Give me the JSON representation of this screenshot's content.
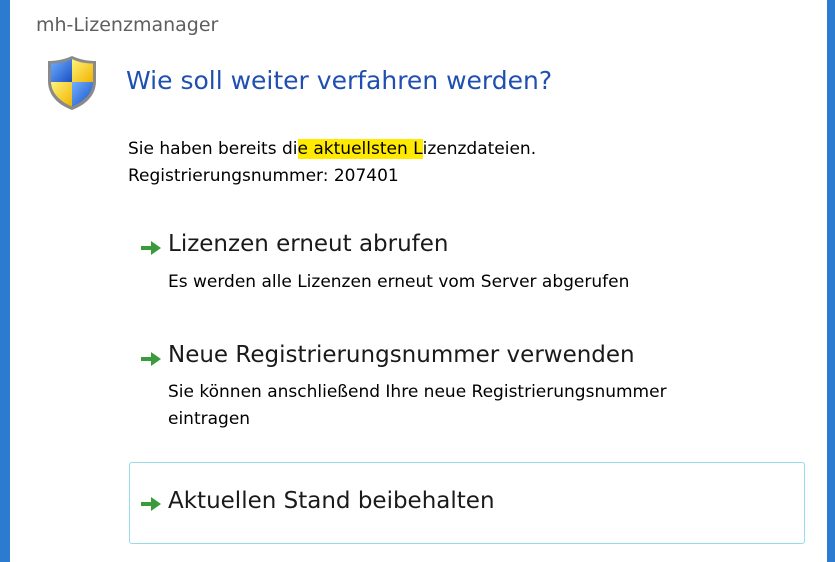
{
  "window": {
    "title": "mh-Lizenzmanager"
  },
  "dialog": {
    "icon": "uac-shield-icon",
    "main_instruction": "Wie soll weiter verfahren werden?",
    "content": {
      "line1_before": "Sie haben bereits di",
      "line1_highlight": "e aktuellsten L",
      "line1_after": "izenzdateien.",
      "line2": "Registrierungsnummer: 207401"
    },
    "highlight_color": "#ffea00",
    "accent_color": "#1f4fb0",
    "arrow_color": "#3a9b3a"
  },
  "commands": [
    {
      "label": "Lizenzen erneut abrufen",
      "note_lines": [
        "Es werden alle Lizenzen erneut vom Server abgerufen"
      ],
      "icon": "green-arrow-icon"
    },
    {
      "label": "Neue Registrierungsnummer verwenden",
      "note_lines": [
        "Sie können anschließend Ihre neue Registrierungsnummer",
        "eintragen"
      ],
      "icon": "green-arrow-icon"
    },
    {
      "label": "Aktuellen Stand beibehalten",
      "note_lines": [],
      "icon": "green-arrow-icon",
      "state": "hover"
    }
  ]
}
